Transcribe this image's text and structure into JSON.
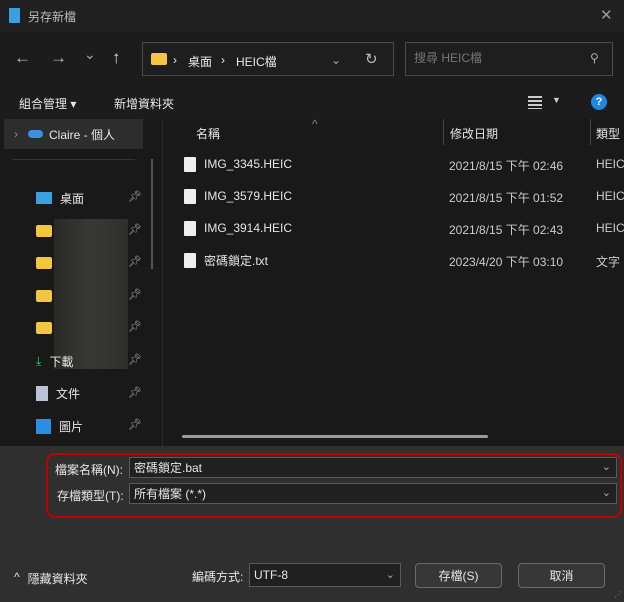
{
  "window": {
    "title": "另存新檔",
    "close": "✕"
  },
  "nav": {
    "back": "←",
    "forward": "→",
    "recent": "⌄",
    "up": "↑",
    "breadcrumb": [
      "桌面",
      "HEIC檔"
    ],
    "refresh": "↻",
    "search_placeholder": "搜尋 HEIC檔"
  },
  "toolbar": {
    "organize": "組合管理 ▾",
    "new_folder": "新增資料夾",
    "help": "?"
  },
  "sidebar": {
    "onedrive": "Claire - 個人",
    "items": [
      {
        "label": "桌面",
        "icon": "desktop-icon"
      },
      {
        "label": "",
        "icon": "folder-icon"
      },
      {
        "label": "",
        "icon": "folder-icon"
      },
      {
        "label": "",
        "icon": "folder-icon"
      },
      {
        "label": "",
        "icon": "folder-icon"
      },
      {
        "label": "下載",
        "icon": "download-icon"
      },
      {
        "label": "文件",
        "icon": "document-icon"
      },
      {
        "label": "圖片",
        "icon": "pictures-icon"
      }
    ]
  },
  "columns": {
    "name": "名稱",
    "modified": "修改日期",
    "type": "類型"
  },
  "files": [
    {
      "name": "IMG_3345.HEIC",
      "modified": "2021/8/15 下午 02:46",
      "type": "HEIC"
    },
    {
      "name": "IMG_3579.HEIC",
      "modified": "2021/8/15 下午 01:52",
      "type": "HEIC"
    },
    {
      "name": "IMG_3914.HEIC",
      "modified": "2021/8/15 下午 02:43",
      "type": "HEIC"
    },
    {
      "name": "密碼鎖定.txt",
      "modified": "2023/4/20 下午 03:10",
      "type": "文字"
    }
  ],
  "form": {
    "filename_label": "檔案名稱(N):",
    "filename_value": "密碼鎖定.bat",
    "filetype_label": "存檔類型(T):",
    "filetype_value": "所有檔案 (*.*)",
    "encoding_label": "編碼方式:",
    "encoding_value": "UTF-8",
    "highlight_color": "#c00000"
  },
  "footer": {
    "hide_folders": "隱藏資料夾",
    "save": "存檔(S)",
    "cancel": "取消"
  }
}
